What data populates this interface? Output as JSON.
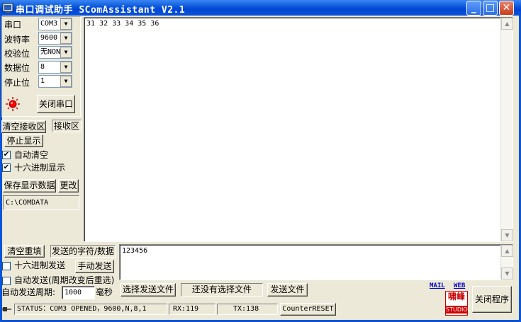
{
  "window": {
    "title": "串口调试助手  SComAssistant V2.1",
    "minimize": "_",
    "maximize": "□",
    "close": "✕"
  },
  "settings": {
    "port_label": "串口",
    "port_value": "COM3",
    "baud_label": "波特率",
    "baud_value": "9600",
    "parity_label": "校验位",
    "parity_value": "无NONE",
    "databits_label": "数据位",
    "databits_value": "8",
    "stopbits_label": "停止位",
    "stopbits_value": "1",
    "close_port_button": "关闭串口",
    "indicator_color": "#ff0000"
  },
  "receive": {
    "clear_button": "清空接收区",
    "area_label": "接收区",
    "stop_display_button": "停止显示",
    "auto_clear_label": "自动清空",
    "auto_clear_checked": true,
    "hex_display_label": "十六进制显示",
    "hex_display_checked": true,
    "save_button": "保存显示数据",
    "change_button": "更改",
    "save_path": "C:\\COMDATA",
    "content": "31 32 33 34 35 36"
  },
  "send": {
    "clear_button": "清空重填",
    "label": "发送的字符/数据",
    "content": "123456",
    "hex_send_label": "十六进制发送",
    "hex_send_checked": false,
    "manual_send_button": "手动发送",
    "auto_send_label": "自动发送(周期改变后重选)",
    "auto_send_checked": false,
    "period_label": "自动发送周期:",
    "period_value": "1000",
    "period_unit": "毫秒",
    "select_file_button": "选择发送文件",
    "file_status": "还没有选择文件",
    "send_file_button": "发送文件"
  },
  "links": {
    "mail": "MAIL",
    "web": "WEB",
    "logo_line1": "啸峰",
    "logo_line2": "STUDIO"
  },
  "exit_button": "关闭程序",
  "status": {
    "text": "STATUS：COM3 OPENED，9600,N,8,1",
    "rx": "RX:119",
    "tx": "TX:138",
    "reset_button": "CounterRESET"
  },
  "colors": {
    "title_bar": "#0a55d9",
    "window_bg": "#ece9d8",
    "link": "#0000cc",
    "logo_red": "#cc0000"
  }
}
